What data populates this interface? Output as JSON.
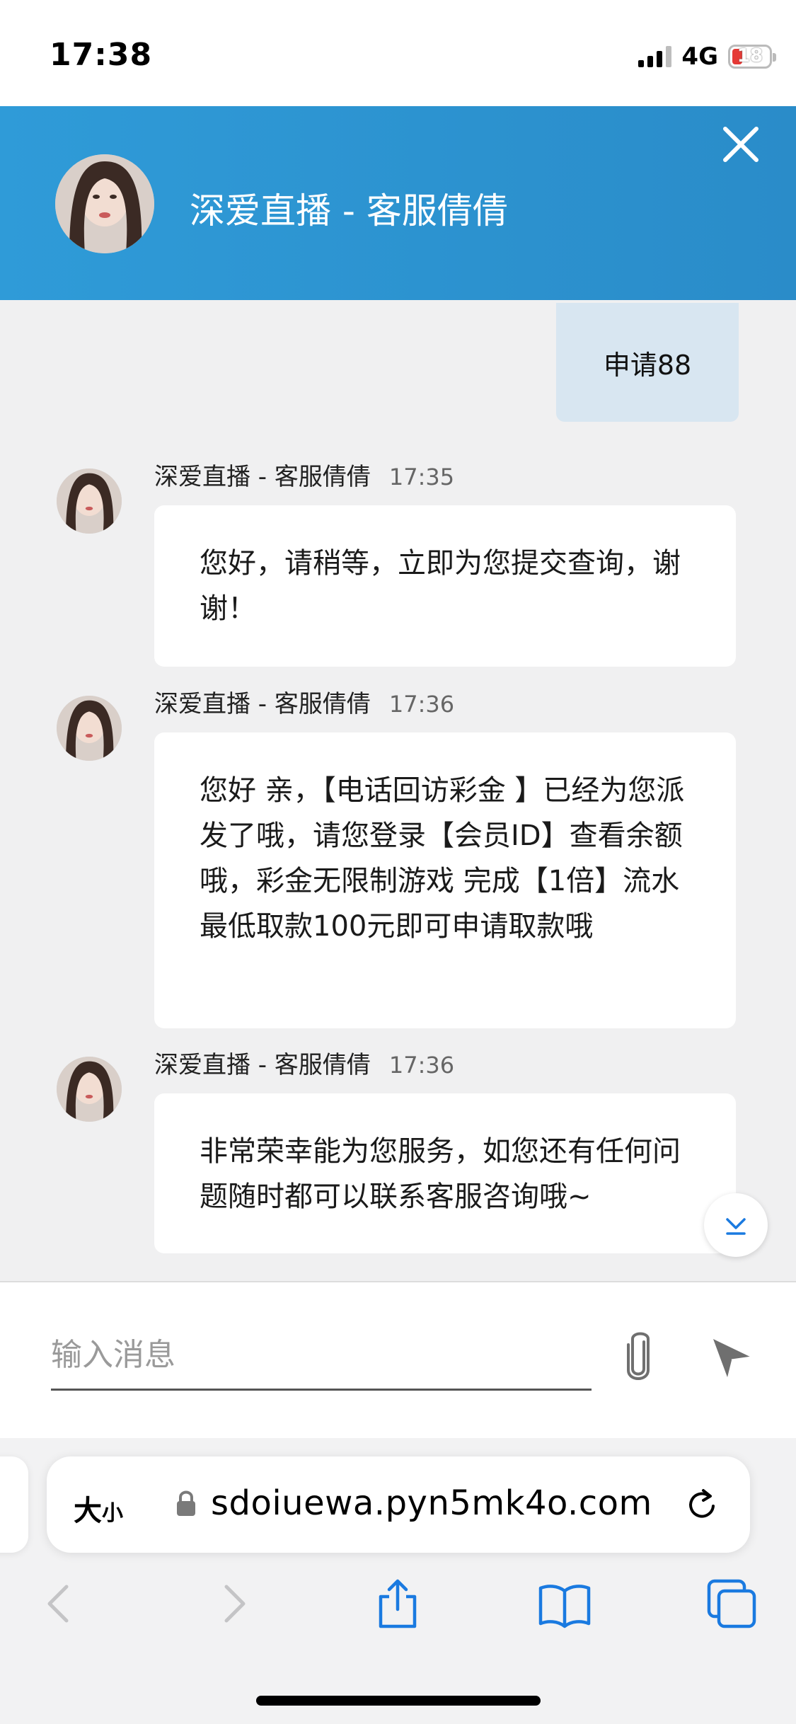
{
  "status_bar": {
    "time": "17:38",
    "network": "4G",
    "battery": "18"
  },
  "header": {
    "title": "深爱直播 - 客服倩倩"
  },
  "chat": {
    "user_message": "申请88",
    "messages": [
      {
        "sender": "深爱直播 - 客服倩倩",
        "time": "17:35",
        "text": "您好，请稍等，立即为您提交查询，谢谢！"
      },
      {
        "sender": "深爱直播 - 客服倩倩",
        "time": "17:36",
        "text": "您好 亲，【电话回访彩金 】已经为您派发了哦，请您登录【会员ID】查看余额哦，彩金无限制游戏 完成【1倍】流水最低取款100元即可申请取款哦"
      },
      {
        "sender": "深爱直播 - 客服倩倩",
        "time": "17:36",
        "text": "非常荣幸能为您服务，如您还有任何问题随时都可以联系客服咨询哦~"
      }
    ]
  },
  "composer": {
    "placeholder": "输入消息",
    "value": ""
  },
  "browser": {
    "text_size_big": "大",
    "text_size_small": "小",
    "url": "sdoiuewa.pyn5mk4o.com"
  },
  "icons": {
    "close": "close-icon",
    "attach": "paperclip-icon",
    "send": "send-icon",
    "scroll_down": "chevron-down-icon",
    "lock": "lock-icon",
    "reload": "reload-icon",
    "back": "back-icon",
    "forward": "forward-icon",
    "share": "share-icon",
    "bookmarks": "bookmarks-icon",
    "tabs": "tabs-icon"
  },
  "colors": {
    "header": "#2f9bd8",
    "user_bubble": "#d8e6f1",
    "safari_blue": "#1a7ae0"
  }
}
